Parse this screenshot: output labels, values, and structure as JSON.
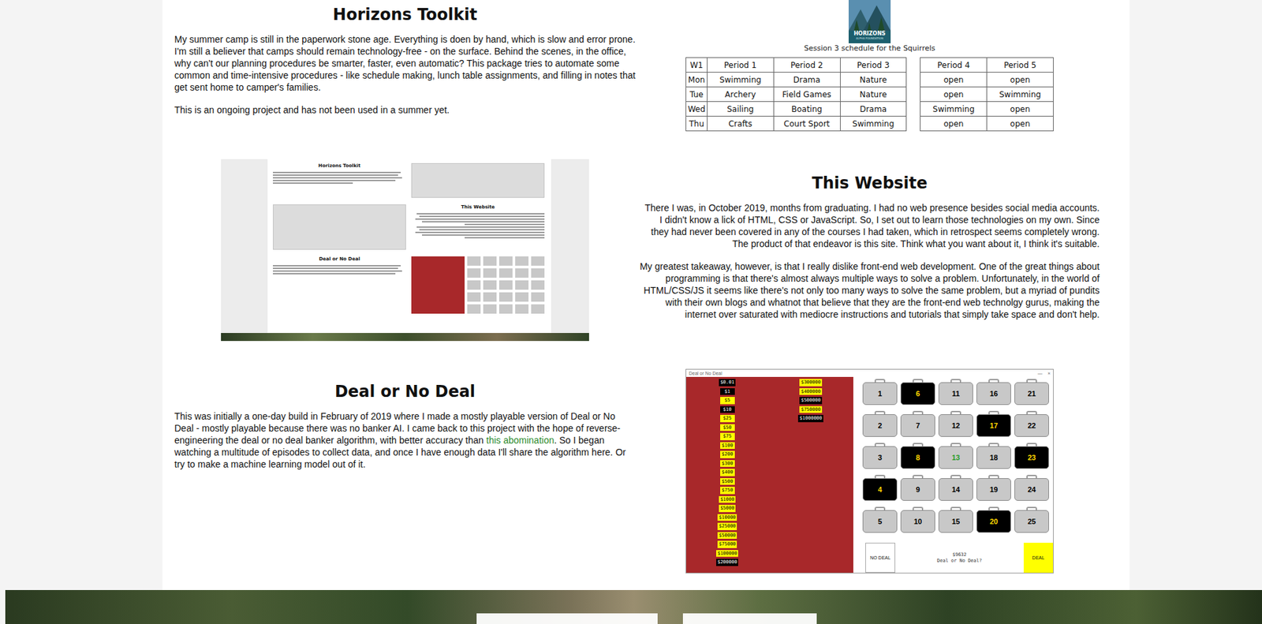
{
  "horizons": {
    "title": "Horizons Toolkit",
    "paragraphs": [
      [
        {
          "text": "My summer camp is still in the paperwork stone age. Everything is doen by hand, which is slow and error prone. I'm still a believer that camps should remain technology-free - on the surface. Behind the scenes, in the office, why can't our planning procedures be smarter, faster, even automatic? This package tries to automate some common and time-intensive procedures - like schedule making, lunch table assignments, and filling in notes that get sent home to camper's families.",
          "link": false
        }
      ],
      [
        {
          "text": "This is an ongoing project and has not been used in a summer yet.",
          "link": false
        }
      ]
    ],
    "schedule": {
      "logo": {
        "name": "HORIZONS",
        "subtitle": "ALPHA FOUNDATION"
      },
      "caption": "Session 3 schedule for the Squirrels",
      "columns": [
        "W1",
        "Period 1",
        "Period 2",
        "Period 3",
        "Period 4",
        "Period 5"
      ],
      "rows": [
        {
          "day": "Mon",
          "cells": [
            "Swimming",
            "Drama",
            "Nature",
            "open",
            "open"
          ]
        },
        {
          "day": "Tue",
          "cells": [
            "Archery",
            "Field Games",
            "Nature",
            "open",
            "Swimming"
          ]
        },
        {
          "day": "Wed",
          "cells": [
            "Sailing",
            "Boating",
            "Drama",
            "Swimming",
            "open"
          ]
        },
        {
          "day": "Thu",
          "cells": [
            "Crafts",
            "Court Sport",
            "Swimming",
            "open",
            "open"
          ]
        }
      ]
    }
  },
  "website": {
    "title": "This Website",
    "paragraphs": [
      [
        {
          "text": "There I was, in October 2019, months from graduating. I had no web presence besides social media accounts. I didn't know a lick of HTML, CSS or JavaScript. So, I set out to learn those technologies on my own. Since they had never been covered in any of the courses I had taken, which in retrospect seems completely wrong. The product of that endeavor is this site. Think what you want about it, I think it's suitable.",
          "link": false
        }
      ],
      [
        {
          "text": "My greatest takeaway, however, is that I really dislike front-end web development. One of the great things about programming is that there's almost always multiple ways to solve a problem. Unfortunately, in the world of HTML/CSS/JS it seems like there's not only too many ways to solve the same problem, but a myriad of pundits with their own blogs and whatnot that believe that they are the front-end web technolgy gurus, making the internet over saturated with mediocre instructions and tutorials that simply take space and don't help.",
          "link": false
        }
      ]
    ],
    "miniature": {
      "headings": [
        "Horizons Toolkit",
        "This Website",
        "Deal or No Deal"
      ]
    }
  },
  "deal": {
    "title": "Deal or No Deal",
    "paragraphs": [
      [
        {
          "text": "This was initially a one-day build in February of 2019 where I made a mostly playable version of Deal or No Deal - mostly playable because there was no banker AI. I came back to this project with the hope of reverse-engineering the deal or no deal banker algorithm, with better accuracy than ",
          "link": false
        },
        {
          "text": "this abomination",
          "link": true
        },
        {
          "text": ". So I began watching a multitude of episodes to collect data, and once I have enough data I'll share the algorithm here. Or try to make a machine learning model out of it.",
          "link": false
        }
      ]
    ],
    "game": {
      "window": {
        "title": "Deal or No Deal",
        "controls": [
          "—",
          "×"
        ]
      },
      "board": [
        [
          {
            "amount": "$0.01",
            "eliminated": true
          },
          {
            "amount": "$1",
            "eliminated": true
          },
          {
            "amount": "$5",
            "eliminated": false
          },
          {
            "amount": "$10",
            "eliminated": true
          },
          {
            "amount": "$25",
            "eliminated": false
          },
          {
            "amount": "$50",
            "eliminated": false
          },
          {
            "amount": "$75",
            "eliminated": false
          },
          {
            "amount": "$100",
            "eliminated": false
          },
          {
            "amount": "$200",
            "eliminated": false
          },
          {
            "amount": "$300",
            "eliminated": false
          },
          {
            "amount": "$400",
            "eliminated": false
          },
          {
            "amount": "$500",
            "eliminated": false
          },
          {
            "amount": "$750",
            "eliminated": false
          },
          {
            "amount": "$1000",
            "eliminated": false
          },
          {
            "amount": "$5000",
            "eliminated": false
          },
          {
            "amount": "$10000",
            "eliminated": false
          },
          {
            "amount": "$25000",
            "eliminated": false
          },
          {
            "amount": "$50000",
            "eliminated": false
          },
          {
            "amount": "$75000",
            "eliminated": false
          },
          {
            "amount": "$100000",
            "eliminated": false
          },
          {
            "amount": "$200000",
            "eliminated": true
          }
        ],
        [
          {
            "amount": "$300000",
            "eliminated": false
          },
          {
            "amount": "$400000",
            "eliminated": false
          },
          {
            "amount": "$500000",
            "eliminated": true
          },
          {
            "amount": "$750000",
            "eliminated": false
          },
          {
            "amount": "$1000000",
            "eliminated": true
          }
        ]
      ],
      "cases": [
        {
          "number": "1",
          "opened": false,
          "selected": false
        },
        {
          "number": "2",
          "opened": false,
          "selected": false
        },
        {
          "number": "3",
          "opened": false,
          "selected": false
        },
        {
          "number": "4",
          "opened": true,
          "selected": false
        },
        {
          "number": "5",
          "opened": false,
          "selected": false
        },
        {
          "number": "6",
          "opened": true,
          "selected": false
        },
        {
          "number": "7",
          "opened": false,
          "selected": false
        },
        {
          "number": "8",
          "opened": true,
          "selected": false
        },
        {
          "number": "9",
          "opened": false,
          "selected": false
        },
        {
          "number": "10",
          "opened": false,
          "selected": false
        },
        {
          "number": "11",
          "opened": false,
          "selected": false
        },
        {
          "number": "12",
          "opened": false,
          "selected": false
        },
        {
          "number": "13",
          "opened": false,
          "selected": true
        },
        {
          "number": "14",
          "opened": false,
          "selected": false
        },
        {
          "number": "15",
          "opened": false,
          "selected": false
        },
        {
          "number": "16",
          "opened": false,
          "selected": false
        },
        {
          "number": "17",
          "opened": true,
          "selected": false
        },
        {
          "number": "18",
          "opened": false,
          "selected": false
        },
        {
          "number": "19",
          "opened": false,
          "selected": false
        },
        {
          "number": "20",
          "opened": true,
          "selected": false
        },
        {
          "number": "21",
          "opened": false,
          "selected": false
        },
        {
          "number": "22",
          "opened": false,
          "selected": false
        },
        {
          "number": "23",
          "opened": true,
          "selected": false
        },
        {
          "number": "24",
          "opened": false,
          "selected": false
        },
        {
          "number": "25",
          "opened": false,
          "selected": false
        }
      ],
      "offer": "$9632",
      "prompt": "Deal or No Deal?",
      "noDeal": "NO DEAL",
      "dealButton": "DEAL"
    }
  }
}
